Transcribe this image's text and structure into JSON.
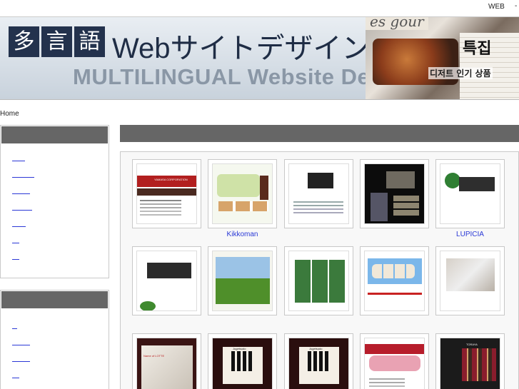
{
  "topbar": {
    "web_label": "WEB",
    "separator": "-"
  },
  "banner": {
    "kanji": [
      "多",
      "言",
      "語"
    ],
    "title": "Webサイトデザイン",
    "subtitle": "MULTILINGUAL Website Design",
    "collage_text_1": "특집",
    "collage_text_2": "디저트 인기 상품",
    "collage_text_3": "es gour"
  },
  "breadcrumb": "Home",
  "sidebar": {
    "box1_links": 7,
    "box2_links": 5
  },
  "gallery": {
    "captions": [
      "",
      "Kikkoman",
      "",
      "",
      "LUPICIA",
      "",
      "",
      "",
      "",
      "",
      "",
      "",
      "",
      "",
      ""
    ],
    "thumb_texts": {
      "t1": "YAMASA CORPORATION",
      "t11": "Name of LOTTE",
      "t12": "Jugetsudo",
      "t13": "Jugetsudo",
      "t15": "TORAYA"
    }
  },
  "colors": {
    "header_bar": "#666666",
    "link": "#2a39d6",
    "banner_dark": "#23324d"
  }
}
